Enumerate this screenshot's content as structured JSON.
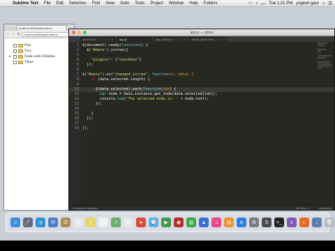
{
  "menubar": {
    "apple": "",
    "app_name": "Sublime Text",
    "menus": [
      "File",
      "Edit",
      "Selection",
      "Find",
      "View",
      "Goto",
      "Tools",
      "Project",
      "Window",
      "Help",
      "Folders"
    ],
    "clock": "Tue 1:21 PM",
    "user": "yogesh gaur"
  },
  "browser": {
    "tab_label": "localhost:8080/jstree/demo",
    "url": "localhost:8080/jstree/demo",
    "nodes": [
      {
        "label": "One",
        "expandable": false
      },
      {
        "label": "Two",
        "expandable": false
      },
      {
        "label": "Node with Children",
        "expandable": true
      },
      {
        "label": "Three",
        "expandable": false
      }
    ]
  },
  "sublime": {
    "window_title": "app.js — jstree",
    "tabs": [
      {
        "label": "index.html"
      },
      {
        "label": "app.js",
        "active": true
      },
      {
        "label": "app_demo.js"
      },
      {
        "label": "styles_jstree.html"
      }
    ],
    "lines": [
      {
        "n": "1",
        "tokens": [
          [
            "$(document).ready(",
            "c-punc"
          ],
          [
            "function",
            "c-prop"
          ],
          [
            "() {",
            "c-punc"
          ]
        ]
      },
      {
        "n": "2",
        "tokens": [
          [
            "  $(",
            "c-punc"
          ],
          [
            "'#data'",
            "c-str"
          ],
          [
            ").jstree({",
            "c-punc"
          ]
        ]
      },
      {
        "n": "3",
        "tokens": [
          [
            "",
            "c-punc"
          ]
        ]
      },
      {
        "n": "4",
        "tokens": [
          [
            "    ",
            "c-punc"
          ],
          [
            "\"plugins\"",
            "c-str"
          ],
          [
            ": [",
            "c-punc"
          ],
          [
            "\"checkbox\"",
            "c-str"
          ],
          [
            "]",
            "c-punc"
          ]
        ]
      },
      {
        "n": "5",
        "tokens": [
          [
            "  });",
            "c-punc"
          ]
        ]
      },
      {
        "n": "6",
        "tokens": [
          [
            "",
            "c-punc"
          ]
        ]
      },
      {
        "n": "7",
        "tokens": [
          [
            "$(",
            "c-punc"
          ],
          [
            "\"#data\"",
            "c-str"
          ],
          [
            ").on(",
            "c-punc"
          ],
          [
            "\"changed.jstree\"",
            "c-str"
          ],
          [
            ", ",
            "c-punc"
          ],
          [
            "function",
            "c-prop"
          ],
          [
            "(e, data) {",
            "c-var"
          ]
        ]
      },
      {
        "n": "8",
        "tokens": [
          [
            "    ",
            "c-punc"
          ],
          [
            "if",
            "c-kw"
          ],
          [
            " (data.selected.length) {",
            "c-punc"
          ]
        ]
      },
      {
        "n": "9",
        "tokens": [
          [
            "",
            "c-punc"
          ]
        ]
      },
      {
        "n": "10",
        "tokens": [
          [
            "      $(data.selected).each(",
            "c-punc"
          ],
          [
            "function",
            "c-prop"
          ],
          [
            "(",
            "c-punc"
          ],
          [
            "idx",
            "c-var"
          ],
          [
            ") {",
            "c-punc"
          ]
        ]
      },
      {
        "n": "11",
        "tokens": [
          [
            "        ",
            "c-punc"
          ],
          [
            "var",
            "c-prop"
          ],
          [
            " node = data.instance.get_node(data.selected[",
            "c-punc"
          ],
          [
            "idx",
            "c-punc"
          ],
          [
            "]);",
            "c-punc"
          ]
        ]
      },
      {
        "n": "12",
        "tokens": [
          [
            "        console.",
            "c-punc"
          ],
          [
            "log",
            "c-prop"
          ],
          [
            "(",
            "c-punc"
          ],
          [
            "'The selected node is: '",
            "c-str"
          ],
          [
            " + node.text);",
            "c-punc"
          ]
        ]
      },
      {
        "n": "13",
        "tokens": [
          [
            "      });",
            "c-punc"
          ]
        ]
      },
      {
        "n": "14",
        "tokens": [
          [
            "",
            "c-punc"
          ]
        ]
      },
      {
        "n": "15",
        "tokens": [
          [
            "    }",
            "c-punc"
          ]
        ]
      },
      {
        "n": "16",
        "tokens": [
          [
            "  });",
            "c-punc"
          ]
        ]
      },
      {
        "n": "17",
        "tokens": [
          [
            "",
            "c-punc"
          ]
        ]
      },
      {
        "n": "18",
        "tokens": [
          [
            "});",
            "c-punc"
          ]
        ]
      }
    ],
    "current_line": 10,
    "status_left": "1 characters selected",
    "status_tab": "Tab Size: 4",
    "status_syntax": "JavaScript"
  },
  "dock": {
    "icons": [
      {
        "name": "finder-icon",
        "glyph": "☺",
        "color": "#3a8ee6"
      },
      {
        "name": "launchpad-icon",
        "glyph": "🚀",
        "color": "#5b6d86"
      },
      {
        "name": "safari-icon",
        "glyph": "◎",
        "color": "#2d8fd8"
      },
      {
        "name": "mail-icon",
        "glyph": "✉",
        "color": "#4c7fc4"
      },
      {
        "name": "contacts-icon",
        "glyph": "☰",
        "color": "#b18a54"
      },
      {
        "name": "calendar-icon",
        "glyph": "27",
        "color": "#e8e8e8"
      },
      {
        "name": "notes-icon",
        "glyph": "≡",
        "color": "#e9d36a"
      },
      {
        "name": "reminders-icon",
        "glyph": "☑",
        "color": "#efefef"
      },
      {
        "name": "maps-icon",
        "glyph": "➚",
        "color": "#6cb06c"
      },
      {
        "name": "photos-icon",
        "glyph": "✿",
        "color": "#e7e7e7"
      },
      {
        "name": "chrome-icon",
        "glyph": "●",
        "color": "#d94a3a"
      },
      {
        "name": "messages-icon",
        "glyph": "💬",
        "color": "#5bb4f3"
      },
      {
        "name": "facetime-icon",
        "glyph": "▶",
        "color": "#3e9a4e"
      },
      {
        "name": "photo-booth-icon",
        "glyph": "◉",
        "color": "#b3302c"
      },
      {
        "name": "numbers-icon",
        "glyph": "▥",
        "color": "#3ba647"
      },
      {
        "name": "keynote-icon",
        "glyph": "▲",
        "color": "#3b6fd6"
      },
      {
        "name": "itunes-icon",
        "glyph": "♫",
        "color": "#e44a8d"
      },
      {
        "name": "ibooks-icon",
        "glyph": "▤",
        "color": "#f0922f"
      },
      {
        "name": "app-store-icon",
        "glyph": "A",
        "color": "#2f7fe0"
      },
      {
        "name": "system-preferences-icon",
        "glyph": "⚙",
        "color": "#7a7d84"
      },
      {
        "name": "sublime-text-icon",
        "glyph": "S",
        "color": "#4a4a4a"
      },
      {
        "name": "terminal-icon",
        "glyph": ">_",
        "color": "#222222"
      },
      {
        "name": "emacs-icon",
        "glyph": "ε",
        "color": "#7f5ab6"
      },
      {
        "name": "firefox-icon",
        "glyph": "◐",
        "color": "#e66b24"
      },
      {
        "name": "downloads-icon",
        "glyph": "↓",
        "color": "#5a7fb0"
      },
      {
        "name": "trash-icon",
        "glyph": "🗑",
        "color": "#b7bbc2"
      }
    ]
  }
}
